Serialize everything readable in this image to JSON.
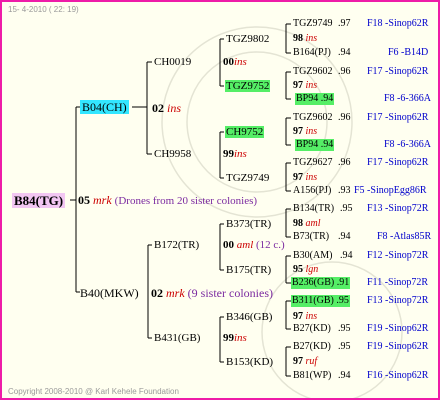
{
  "header": {
    "date": "15-  4-2010 ( 22: 19)"
  },
  "footer": {
    "copyright": "Copyright 2008-2010 @ Karl Kehele Foundation"
  },
  "pedigree": {
    "root": {
      "name": "B84(TG)"
    },
    "g1": [
      {
        "name": "B04(CH)"
      },
      {
        "name": "B40(MKW)"
      }
    ],
    "root_year": {
      "num": "05",
      "ins": "mrk",
      "note": "(Drones from 20 sister colonies)"
    },
    "b04_year": {
      "num": "02",
      "ins": "ins"
    },
    "b40_year": {
      "num": "02",
      "ins": "mrk",
      "note": "(9 sister colonies)"
    },
    "g2": [
      {
        "name": "CH0019"
      },
      {
        "name": "CH9958"
      },
      {
        "name": "B172(TR)"
      },
      {
        "name": "B431(GB)"
      }
    ],
    "g2_years": [
      {
        "num": "00",
        "ins": "ins"
      },
      {
        "num": "99",
        "ins": "ins"
      },
      {
        "num": "00",
        "ins": "aml",
        "note": "(12 c.)"
      },
      {
        "num": "99",
        "ins": "ins"
      }
    ],
    "g3": [
      {
        "name": "TGZ9802"
      },
      {
        "name": "TGZ9752"
      },
      {
        "name": "CH9752"
      },
      {
        "name": "TGZ9749"
      },
      {
        "name": "B373(TR)"
      },
      {
        "name": "B175(TR)"
      },
      {
        "name": "B346(GB)"
      },
      {
        "name": "B153(KD)"
      }
    ],
    "g3_years": [
      {
        "num": "98",
        "ins": "ins"
      },
      {
        "num": "97",
        "ins": "ins"
      },
      {
        "num": "97",
        "ins": "ins"
      },
      {
        "num": "97",
        "ins": "ins"
      },
      {
        "num": "98",
        "ins": "aml"
      },
      {
        "num": "95",
        "ins": "lgn"
      },
      {
        "num": "97",
        "ins": "ins"
      },
      {
        "num": "97",
        "ins": "ruf"
      }
    ],
    "g4": [
      {
        "name": "TGZ9749",
        "pct": ".97",
        "line": "F18 -Sinop62R"
      },
      {
        "name": "B164(PJ)",
        "pct": ".94",
        "line": "F6 -B14D"
      },
      {
        "name": "TGZ9602",
        "pct": ".96",
        "line": "F17 -Sinop62R"
      },
      {
        "name": "BP94",
        "pct": ".94",
        "line": "F8 -6-366A"
      },
      {
        "name": "TGZ9602",
        "pct": ".96",
        "line": "F17 -Sinop62R"
      },
      {
        "name": "BP94",
        "pct": ".94",
        "line": "F8 -6-366A"
      },
      {
        "name": "TGZ9627",
        "pct": ".96",
        "line": "F17 -Sinop62R"
      },
      {
        "name": "A156(PJ)",
        "pct": ".93",
        "line": "F5 -SinopEgg86R"
      },
      {
        "name": "B134(TR)",
        "pct": ".95",
        "line": "F13 -Sinop72R"
      },
      {
        "name": "B73(TR)",
        "pct": ".94",
        "line": "F8 -Atlas85R"
      },
      {
        "name": "B30(AM)",
        "pct": ".94",
        "line": "F12 -Sinop72R"
      },
      {
        "name": "B236(GB)",
        "pct": ".91",
        "line": "F11 -Sinop72R"
      },
      {
        "name": "B311(GB)",
        "pct": ".95",
        "line": "F13 -Sinop72R"
      },
      {
        "name": "B27(KD)",
        "pct": ".95",
        "line": "F19 -Sinop62R"
      },
      {
        "name": "B27(KD)",
        "pct": ".95",
        "line": "F19 -Sinop62R"
      },
      {
        "name": "B81(WP)",
        "pct": ".94",
        "line": "F16 -Sinop62R"
      }
    ],
    "g4_years": [
      {
        "num": "98",
        "ins": "ins"
      },
      {
        "num": "97",
        "ins": "ins"
      },
      {
        "num": "97",
        "ins": "ins"
      },
      {
        "num": "97",
        "ins": "ins"
      },
      {
        "num": "98",
        "ins": "aml"
      },
      {
        "num": "95",
        "ins": "lgn"
      },
      {
        "num": "97",
        "ins": "ins"
      },
      {
        "num": "97",
        "ins": "ruf"
      }
    ]
  }
}
